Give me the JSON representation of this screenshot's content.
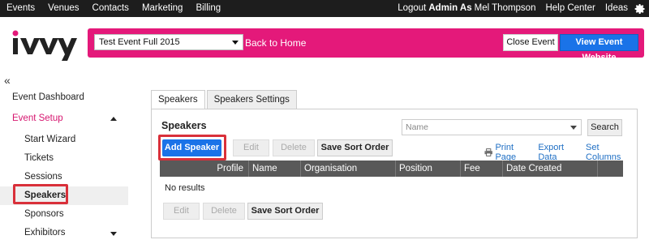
{
  "topnav": {
    "items": [
      "Events",
      "Venues",
      "Contacts",
      "Marketing",
      "Billing"
    ],
    "logout_prefix": "Logout",
    "admin_label": "Admin As",
    "user_name": "Mel Thompson",
    "help": "Help Center",
    "ideas": "Ideas",
    "settings_icon": "gear-icon"
  },
  "header": {
    "logo_text": "iVvy",
    "event_selected": "Test Event Full 2015",
    "back_home": "Back to Home",
    "close_event": "Close Event",
    "view_website": "View Event Website",
    "accent_color": "#e4197a"
  },
  "sidebar": {
    "collapse_icon": "«",
    "items": [
      {
        "label": "Event Dashboard"
      },
      {
        "label": "Event Setup"
      },
      {
        "label": "Start Wizard"
      },
      {
        "label": "Tickets"
      },
      {
        "label": "Sessions"
      },
      {
        "label": "Speakers"
      },
      {
        "label": "Sponsors"
      },
      {
        "label": "Exhibitors"
      }
    ]
  },
  "main": {
    "tabs": [
      {
        "label": "Speakers"
      },
      {
        "label": "Speakers Settings"
      }
    ],
    "title": "Speakers",
    "name_placeholder": "Name",
    "search": "Search",
    "add_speaker": "Add Speaker",
    "edit": "Edit",
    "delete": "Delete",
    "save_sort": "Save Sort Order",
    "print_page": "Print Page",
    "export_data": "Export Data",
    "set_columns": "Set Columns",
    "columns": [
      "Profile",
      "Name",
      "Organisation",
      "Position",
      "Fee",
      "Date Created"
    ],
    "no_results": "No results"
  }
}
